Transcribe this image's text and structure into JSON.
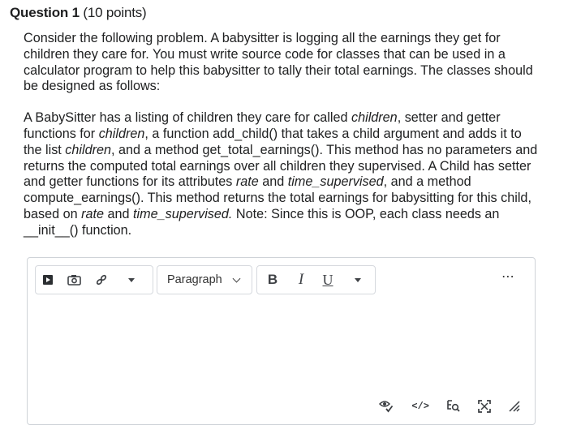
{
  "question": {
    "label": "Question 1",
    "points": "(10 points)"
  },
  "prompt": {
    "para1": "Consider the following problem. A babysitter is logging all the earnings they get for children they care for. You must write source code for classes that can be used in a calculator program to help this babysitter to tally their total earnings. The classes should be designed as follows:",
    "para2": {
      "s1": "A BabySitter has a listing of children they care for called ",
      "e1": "children",
      "s2": ", setter and getter functions for ",
      "e2": "children",
      "s3": ", a function add_child() that takes a child argument and adds it to the list ",
      "e3": "children",
      "s4": ", and a method get_total_earnings(). This method has no parameters and returns the computed total earnings over all children they supervised. A Child has setter and getter functions for its attributes ",
      "e4": "rate",
      "s5": " and ",
      "e5": "time_supervised",
      "s6": ", and a method compute_earnings(). This method returns the total earnings for babysitting for this child, based on ",
      "e6": "rate",
      "s7": " and ",
      "e7": "time_supervised.",
      "s8": " Note: Since this is OOP, each class needs an __init__() function."
    }
  },
  "editor": {
    "toolbar": {
      "block_format": "Paragraph",
      "bold": "B",
      "italic": "I",
      "underline": "U",
      "more": "⋯"
    },
    "icons": [
      "insert-stuff-icon",
      "insert-image-icon",
      "insert-link-icon",
      "spellcheck-icon",
      "html-source-icon",
      "find-replace-icon",
      "fullscreen-icon",
      "resize-handle-icon"
    ],
    "html_source": "</>"
  }
}
